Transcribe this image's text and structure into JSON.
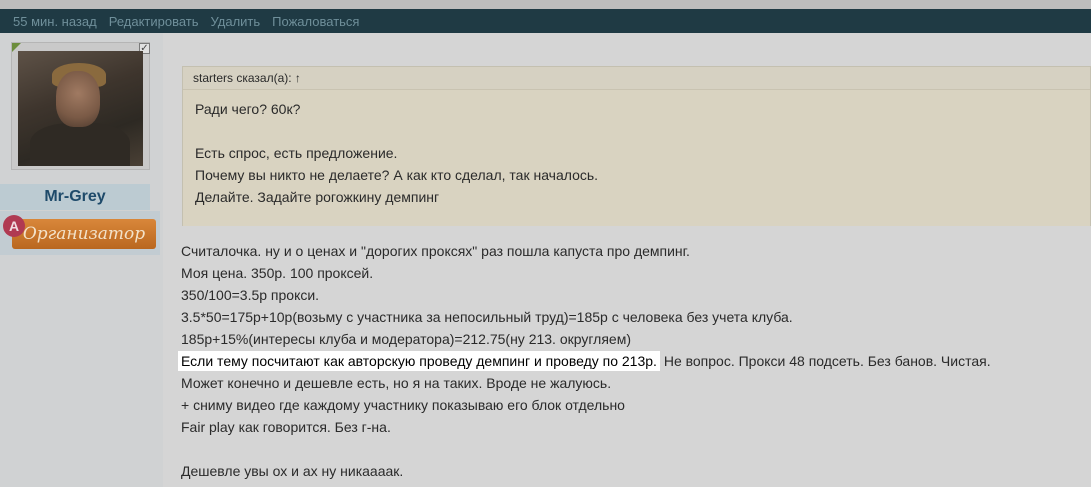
{
  "action_bar": {
    "time": "55 мин. назад",
    "edit": "Редактировать",
    "delete": "Удалить",
    "report": "Пожаловаться"
  },
  "author": {
    "username": "Mr-Grey",
    "role_letter": "A",
    "role": "Организатор",
    "checkbox_mark": "✓"
  },
  "quote": {
    "header": "starters сказал(а): ↑",
    "lines": [
      "Ради чего? 60к?",
      "Есть спрос, есть предложение.",
      "Почему вы никто не делаете? А как кто сделал, так началось.",
      "Делайте. Задайте рогожкину демпинг"
    ]
  },
  "post": {
    "lines": [
      "Считалочка. ну и о ценах и \"дорогих проксях\" раз пошла капуста про демпинг.",
      "Моя цена. 350р. 100 проксей.",
      "350/100=3.5р прокси.",
      "3.5*50=175р+10р(возьму с участника за непосильный труд)=185р с человека без учета клуба.",
      "185р+15%(интересы клуба и модератора)=212.75(ну 213. округляем)"
    ],
    "highlighted": "Если тему посчитают как авторскую проведу демпинг и проведу по 213р.",
    "highlighted_rest": " Не вопрос. Прокси 48 подсеть. Без банов. Чистая.",
    "lines2": [
      "Может конечно и дешевле есть, но я на таких. Вроде не жалуюсь.",
      "+ сниму видео где каждому участнику показываю его блок отдельно",
      "Fair play как говорится. Без г-на."
    ],
    "last": "Дешевле увы ох и ах ну никаааак."
  }
}
